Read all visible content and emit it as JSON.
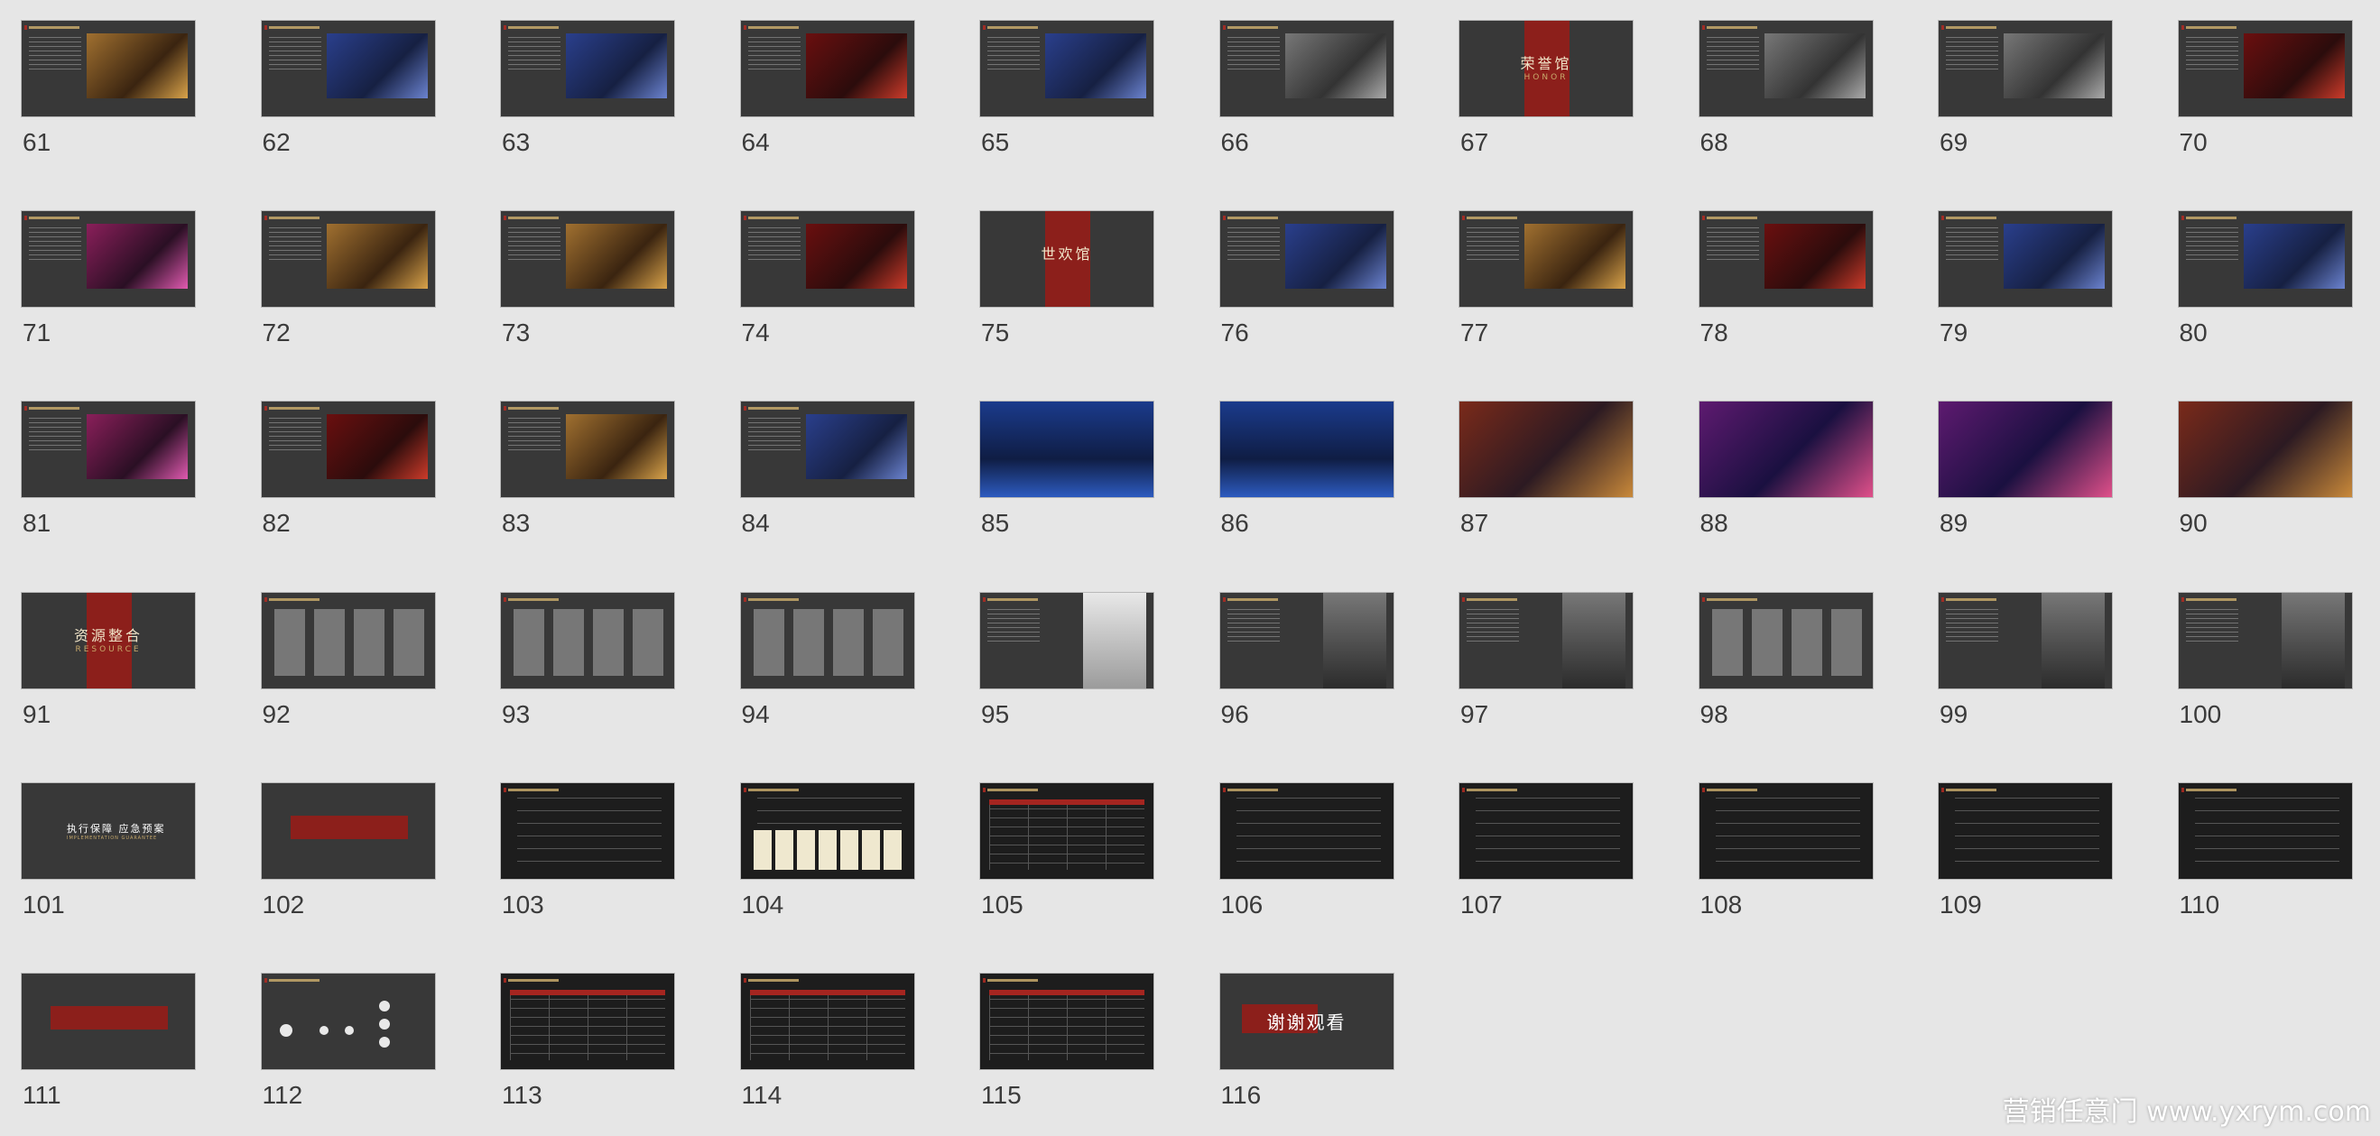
{
  "app": {
    "view": "slide-sorter"
  },
  "slides": [
    {
      "number": "61",
      "style": "dark-image",
      "tone": "warm"
    },
    {
      "number": "62",
      "style": "dark-image",
      "tone": "blue"
    },
    {
      "number": "63",
      "style": "dark-image",
      "tone": "blue"
    },
    {
      "number": "64",
      "style": "dark-image",
      "tone": "red"
    },
    {
      "number": "65",
      "style": "dark-image",
      "tone": "blue"
    },
    {
      "number": "66",
      "style": "dark-image",
      "tone": "gray"
    },
    {
      "number": "67",
      "style": "section",
      "heading": "荣誉馆",
      "sub": "HONOR"
    },
    {
      "number": "68",
      "style": "dark-image",
      "tone": "gray"
    },
    {
      "number": "69",
      "style": "dark-image",
      "tone": "gray"
    },
    {
      "number": "70",
      "style": "dark-image",
      "tone": "red"
    },
    {
      "number": "71",
      "style": "dark-image",
      "tone": "pink"
    },
    {
      "number": "72",
      "style": "dark-image",
      "tone": "warm"
    },
    {
      "number": "73",
      "style": "dark-image",
      "tone": "warm"
    },
    {
      "number": "74",
      "style": "dark-image",
      "tone": "red"
    },
    {
      "number": "75",
      "style": "section",
      "heading": "世欢馆",
      "sub": ""
    },
    {
      "number": "76",
      "style": "dark-image",
      "tone": "blue"
    },
    {
      "number": "77",
      "style": "dark-image",
      "tone": "warm"
    },
    {
      "number": "78",
      "style": "dark-image",
      "tone": "red"
    },
    {
      "number": "79",
      "style": "dark-image",
      "tone": "blue"
    },
    {
      "number": "80",
      "style": "dark-image",
      "tone": "blue"
    },
    {
      "number": "81",
      "style": "dark-image",
      "tone": "pink"
    },
    {
      "number": "82",
      "style": "dark-image",
      "tone": "red"
    },
    {
      "number": "83",
      "style": "dark-image",
      "tone": "warm"
    },
    {
      "number": "84",
      "style": "dark-image",
      "tone": "blue"
    },
    {
      "number": "85",
      "style": "full-photo",
      "tone": "stage"
    },
    {
      "number": "86",
      "style": "full-photo",
      "tone": "stage"
    },
    {
      "number": "87",
      "style": "full-photo",
      "tone": "warm"
    },
    {
      "number": "88",
      "style": "full-photo",
      "tone": "pink"
    },
    {
      "number": "89",
      "style": "full-photo",
      "tone": "pink"
    },
    {
      "number": "90",
      "style": "full-photo",
      "tone": "warm"
    },
    {
      "number": "91",
      "style": "section",
      "heading": "资源整合",
      "sub": "RESOURCE"
    },
    {
      "number": "92",
      "style": "people"
    },
    {
      "number": "93",
      "style": "people"
    },
    {
      "number": "94",
      "style": "people"
    },
    {
      "number": "95",
      "style": "portrait",
      "tone": "light"
    },
    {
      "number": "96",
      "style": "portrait",
      "tone": "dark"
    },
    {
      "number": "97",
      "style": "portrait",
      "tone": "dark"
    },
    {
      "number": "98",
      "style": "people"
    },
    {
      "number": "99",
      "style": "portrait",
      "tone": "dark"
    },
    {
      "number": "100",
      "style": "portrait",
      "tone": "dark"
    },
    {
      "number": "101",
      "style": "title",
      "heading": "执行保障  应急预案",
      "sub": "IMPLEMENTATION GUARANTEE"
    },
    {
      "number": "102",
      "style": "redbox"
    },
    {
      "number": "103",
      "style": "lines"
    },
    {
      "number": "104",
      "style": "cards"
    },
    {
      "number": "105",
      "style": "table"
    },
    {
      "number": "106",
      "style": "black-lines"
    },
    {
      "number": "107",
      "style": "black-lines"
    },
    {
      "number": "108",
      "style": "black-lines"
    },
    {
      "number": "109",
      "style": "black-lines"
    },
    {
      "number": "110",
      "style": "black-lines"
    },
    {
      "number": "111",
      "style": "redbox"
    },
    {
      "number": "112",
      "style": "diagram"
    },
    {
      "number": "113",
      "style": "table"
    },
    {
      "number": "114",
      "style": "table"
    },
    {
      "number": "115",
      "style": "table"
    },
    {
      "number": "116",
      "style": "thanks",
      "heading": "谢谢观看"
    }
  ],
  "watermark": "营销任意门 www.yxrym.com"
}
